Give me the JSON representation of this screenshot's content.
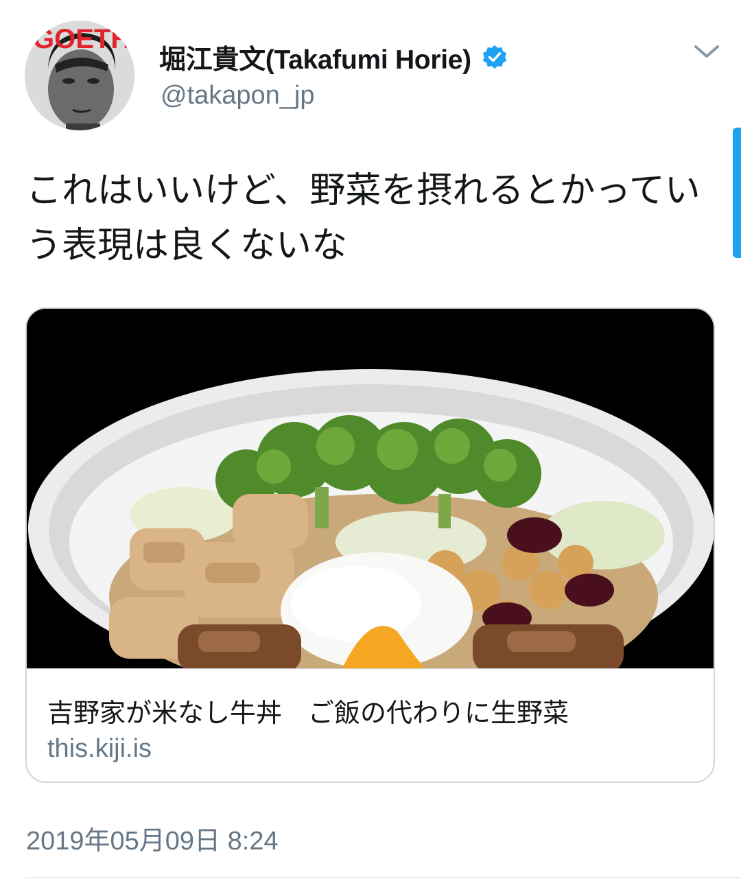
{
  "author": {
    "display_name": "堀江貴文(Takafumi Horie)",
    "handle": "@takapon_jp",
    "verified": true,
    "avatar_text": "GOETHE",
    "avatar_icon": "profile-photo"
  },
  "tweet": {
    "text": "これはいいけど、野菜を摂れるとかっていう表現は良くないな",
    "timestamp": "2019年05月09日 8:24"
  },
  "link_card": {
    "title": "吉野家が米なし牛丼　ご飯の代わりに生野菜",
    "domain": "this.kiji.is",
    "image_icon": "food-bowl-photo"
  },
  "colors": {
    "accent": "#1da1f2",
    "secondary_text": "#657786",
    "border": "#ccd6dd"
  }
}
